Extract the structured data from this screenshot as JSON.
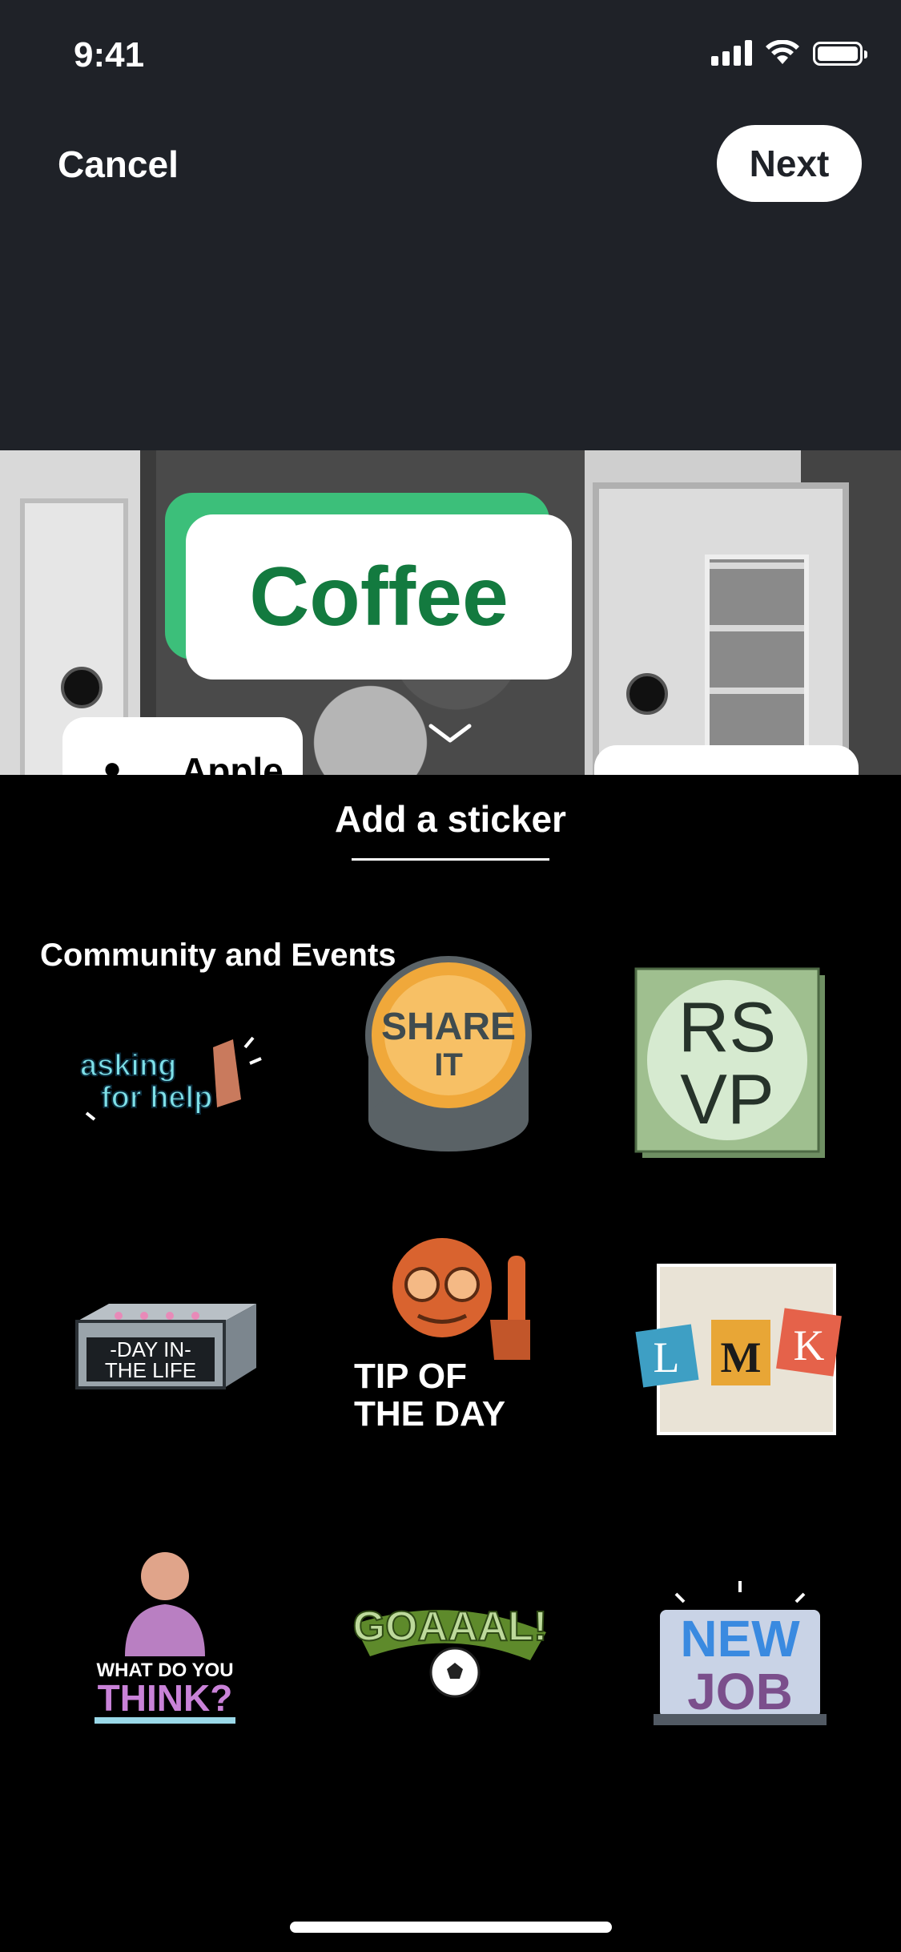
{
  "status_bar": {
    "time": "9:41"
  },
  "header": {
    "cancel_label": "Cancel",
    "next_label": "Next"
  },
  "canvas": {
    "coffee_sticker_text": "Coffee",
    "apple_sticker_text": "Apple"
  },
  "sheet": {
    "title": "Add a sticker",
    "section_title": "Community and Events",
    "stickers": [
      {
        "label_line1": "asking",
        "label_line2": "for help"
      },
      {
        "label_line1": "SHARE",
        "label_line2": "IT"
      },
      {
        "label_line1": "RS",
        "label_line2": "VP"
      },
      {
        "label_line1": "-DAY IN-",
        "label_line2": "THE LIFE"
      },
      {
        "label_line1": "TIP OF",
        "label_line2": "THE DAY"
      },
      {
        "label_line1": "L",
        "label_line2": "M",
        "label_line3": "K"
      },
      {
        "label_line1": "WHAT DO YOU",
        "label_line2": "THINK?"
      },
      {
        "label_line1": "GOAAAL!"
      },
      {
        "label_line1": "NEW",
        "label_line2": "JOB"
      }
    ]
  },
  "colors": {
    "top_bg": "#1f2228",
    "coffee_green": "#137a3f",
    "coffee_shadow": "#3cbf7a"
  }
}
